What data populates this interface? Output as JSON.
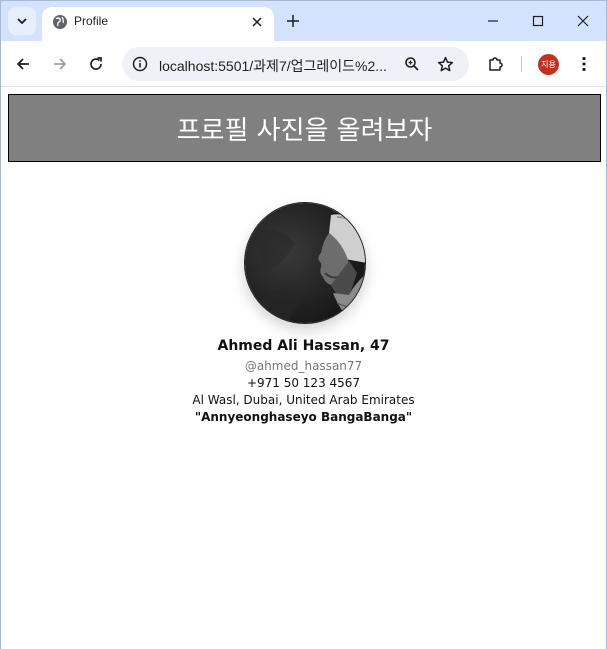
{
  "browser": {
    "tab_title": "Profile",
    "url": "localhost:5501/과제7/업그레이드%2...",
    "profile_initials": "지용",
    "icons": {
      "tab_search": "chevron-down-icon",
      "favicon": "globe-icon",
      "close": "close-icon",
      "new_tab": "plus-icon",
      "back": "arrow-left-icon",
      "forward": "arrow-right-icon",
      "reload": "reload-icon",
      "site_info": "info-icon",
      "zoom": "zoom-icon",
      "bookmark": "star-icon",
      "extensions": "puzzle-icon",
      "menu": "kebab-menu-icon"
    }
  },
  "page": {
    "header_title": "프로필 사진을 올려보자",
    "header_bg": "#808080",
    "profile": {
      "name": "Ahmed Ali Hassan, 47",
      "handle": "@ahmed_hassan77",
      "phone": "+971 50 123 4567",
      "location": "Al Wasl, Dubai, United Arab Emirates",
      "quote": "\"Annyeonghaseyo BangaBanga\""
    }
  }
}
